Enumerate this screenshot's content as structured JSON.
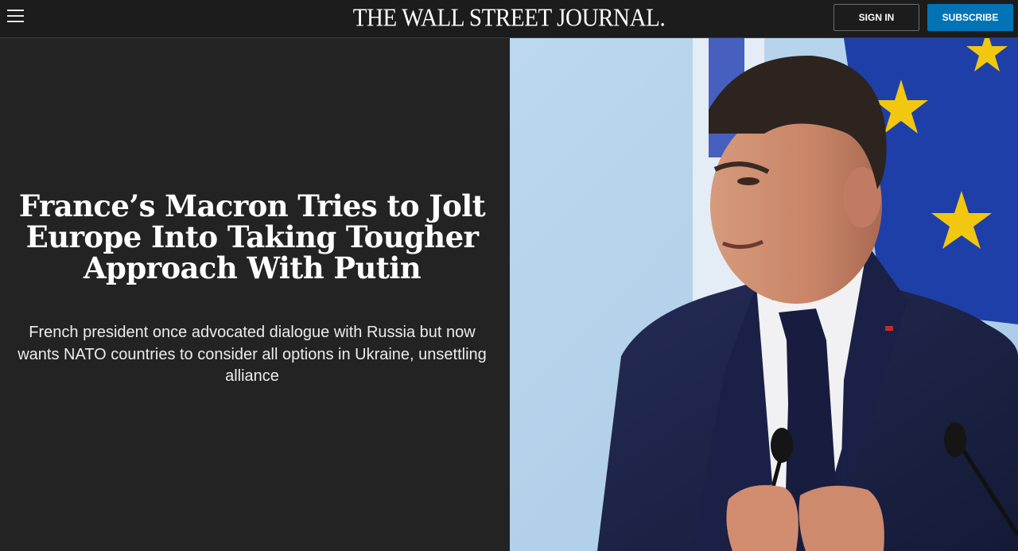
{
  "header": {
    "menu_icon": "hamburger-menu-icon",
    "logo_text": "THE WALL STREET JOURNAL.",
    "signin_label": "SIGN IN",
    "subscribe_label": "SUBSCRIBE"
  },
  "article": {
    "headline": "France’s Macron Tries to Jolt Europe Into Taking Tougher Approach With Putin",
    "dek": "French president once advocated dialogue with Russia but now wants NATO countries to consider all options in Ukraine, unsettling alliance"
  },
  "colors": {
    "background": "#232323",
    "header": "#1c1c1c",
    "subscribe": "#0274b6",
    "eu_blue": "#1f3fa8",
    "eu_star": "#f2c70f",
    "suit": "#1d2447"
  }
}
